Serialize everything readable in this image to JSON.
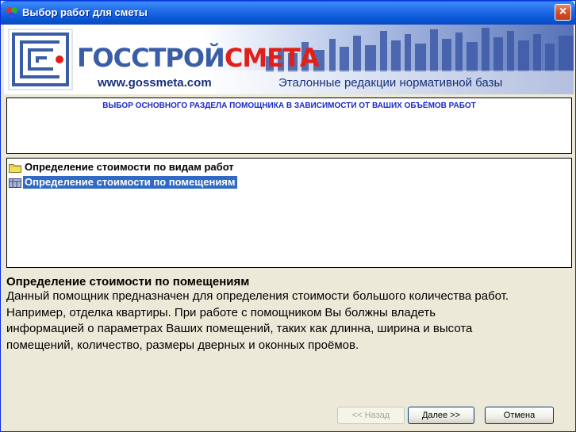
{
  "window": {
    "title": "Выбор работ для сметы"
  },
  "banner": {
    "logo_part1": "ГОССТРОЙ",
    "logo_part2": "СМЕТА",
    "url": "www.gossmeta.com",
    "tagline": "Эталонные редакции нормативной базы"
  },
  "header_panel": {
    "text": "ВЫБОР ОСНОВНОГО РАЗДЕЛА ПОМОЩНИКА В ЗАВИСИМОСТИ ОТ ВАШИХ ОБЪЁМОВ РАБОТ"
  },
  "tree": {
    "items": [
      {
        "label": "Определение стоимости по видам работ",
        "icon": "folder-icon",
        "selected": false
      },
      {
        "label": "Определение стоимости по помещениям",
        "icon": "room-icon",
        "selected": true
      }
    ]
  },
  "description": {
    "title": "Определение стоимости по помещениям",
    "lines": [
      "Данный помощник предназначен для определения стоимости большого количества работ.",
      "Например, отделка квартиры. При работе с помощником Вы болжны владеть",
      "информацией о параметрах Ваших помещений, таких как длинна, ширина и высота",
      "помещений, количество, размеры  дверных и оконных проёмов."
    ]
  },
  "buttons": {
    "back": "<< Назад",
    "next": "Далее >>",
    "cancel": "Отмена"
  },
  "colors": {
    "title_blue": "#0a5bd9",
    "header_text": "#1a2bc8",
    "selection": "#316ac5",
    "logo_red": "#e02018",
    "logo_blue": "#3a5da8"
  }
}
